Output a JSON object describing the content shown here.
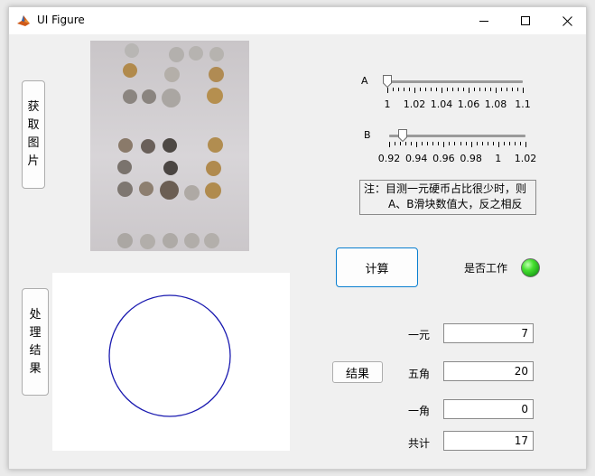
{
  "window": {
    "title": "UI Figure",
    "icon": "matlab-icon"
  },
  "buttons": {
    "get_image": "获取图片",
    "process_result": "处理结果",
    "calculate": "计算",
    "result": "结果"
  },
  "slider_a": {
    "label": "A",
    "value": 1.0,
    "min": 1.0,
    "max": 1.1,
    "major_ticks": [
      "1",
      "1.02",
      "1.04",
      "1.06",
      "1.08",
      "1.1"
    ]
  },
  "slider_b": {
    "label": "B",
    "value": 0.93,
    "min": 0.92,
    "max": 1.02,
    "major_ticks": [
      "0.92",
      "0.94",
      "0.96",
      "0.98",
      "1",
      "1.02"
    ]
  },
  "note": {
    "line1": "注：目测一元硬币占比很少时，则",
    "line2": "A、B滑块数值大，反之相反"
  },
  "lamp": {
    "label": "是否工作",
    "color": "#2dbb22"
  },
  "fields": {
    "one_yuan": {
      "label": "一元",
      "value": "7"
    },
    "five_jiao": {
      "label": "五角",
      "value": "20"
    },
    "one_jiao": {
      "label": "一角",
      "value": "0"
    },
    "total": {
      "label": "共计",
      "value": "17"
    }
  },
  "colors": {
    "circle_stroke": "#1a1ab0",
    "calc_border": "#0a7fd0"
  }
}
